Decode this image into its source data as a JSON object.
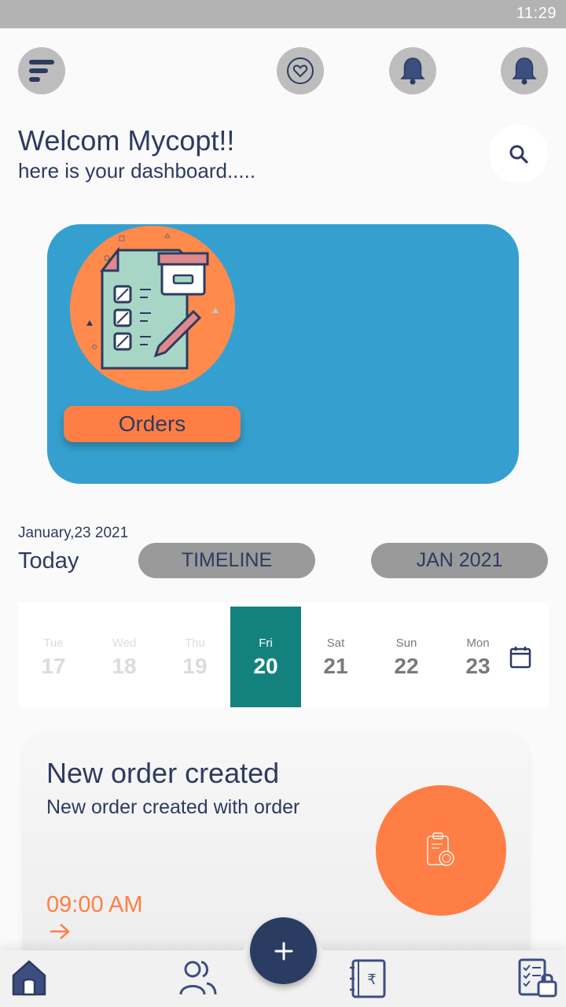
{
  "status_bar": {
    "time": "11:29"
  },
  "header": {
    "icons": [
      "menu-icon",
      "heart-icon",
      "bell-icon",
      "bell-icon"
    ]
  },
  "greeting": {
    "title": "Welcom Mycopt!!",
    "subtitle": "here is your dashboard....."
  },
  "banner": {
    "button_label": "Orders",
    "color": "#35a0cf",
    "button_color": "#ff7e45"
  },
  "schedule": {
    "date": "January,23 2021",
    "today_label": "Today",
    "timeline_label": "TIMELINE",
    "month_label": "JAN 2021"
  },
  "days": [
    {
      "name": "Tue",
      "num": "17"
    },
    {
      "name": "Wed",
      "num": "18"
    },
    {
      "name": "Thu",
      "num": "19"
    },
    {
      "name": "Fri",
      "num": "20"
    },
    {
      "name": "Sat",
      "num": "21"
    },
    {
      "name": "Sun",
      "num": "22"
    },
    {
      "name": "Mon",
      "num": "23"
    }
  ],
  "selected_day_color": "#13827f",
  "order_card": {
    "title": "New order created",
    "subtitle": "New order created with order",
    "time": "09:00 AM"
  },
  "bottom_nav": {
    "items": [
      "home-icon",
      "users-icon",
      "fab-plus",
      "rupee-ledger-icon",
      "checklist-icon"
    ]
  }
}
